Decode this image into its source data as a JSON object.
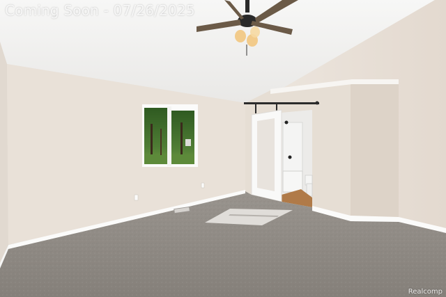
{
  "listing_banner": "Coming Soon - 07/26/2025",
  "watermark": "Realcomp",
  "colors": {
    "ceiling": "#f1f0ee",
    "wall_left": "#e6ded6",
    "wall_back": "#ebe5de",
    "wall_right": "#e8e0d7",
    "carpet": "#8c8782",
    "trim": "#fbfbfa",
    "barn_rail": "#2b2b2b",
    "wood_floor": "#b07a48",
    "window_green": "#3d6a2a"
  }
}
